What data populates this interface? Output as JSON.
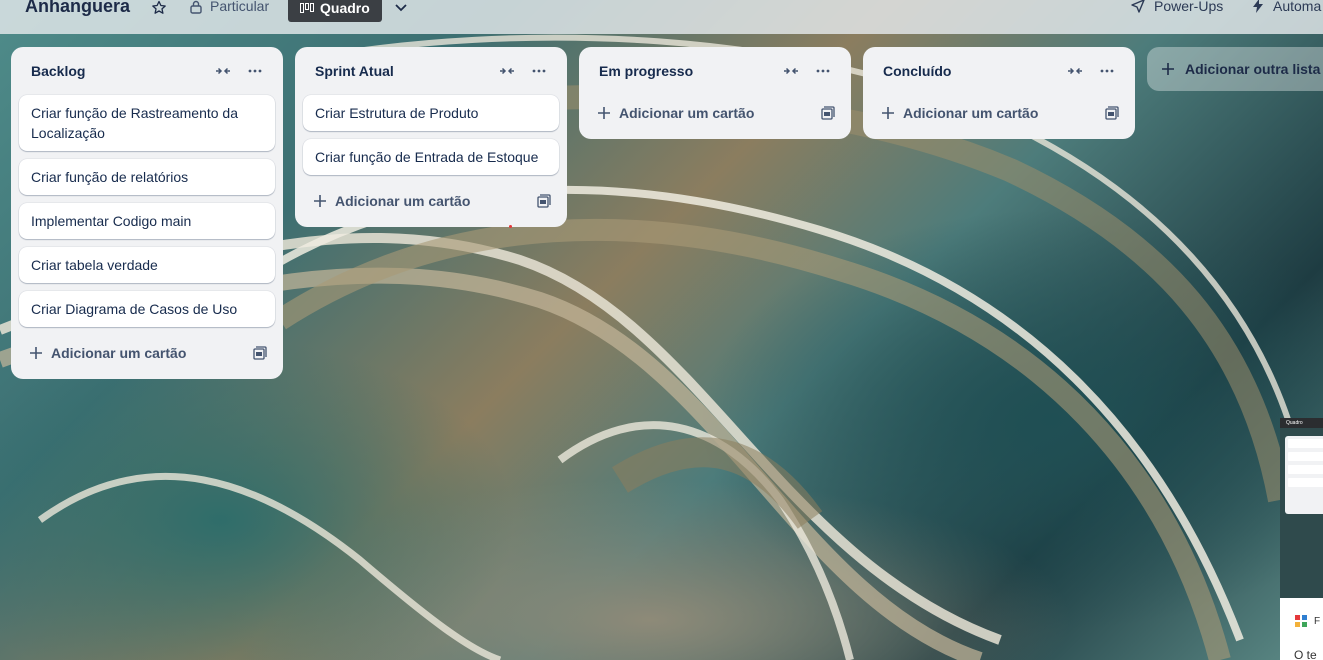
{
  "header": {
    "board_title": "Anhanguera",
    "visibility_label": "Particular",
    "view_label": "Quadro",
    "powerups_label": "Power-Ups",
    "automation_label": "Automa"
  },
  "lists": [
    {
      "title": "Backlog",
      "cards": [
        "Criar função de Rastreamento da Localização",
        "Criar função de relatórios",
        "Implementar Codigo main",
        "Criar tabela verdade",
        "Criar Diagrama de Casos de Uso"
      ],
      "add_card_label": "Adicionar um cartão"
    },
    {
      "title": "Sprint Atual",
      "cards": [
        "Criar Estrutura de Produto",
        "Criar função de Entrada de Estoque"
      ],
      "add_card_label": "Adicionar um cartão"
    },
    {
      "title": "Em progresso",
      "cards": [],
      "add_card_label": "Adicionar um cartão"
    },
    {
      "title": "Concluído",
      "cards": [],
      "add_card_label": "Adicionar um cartão"
    }
  ],
  "add_list_label": "Adicionar outra lista",
  "thumbnail": {
    "label": "Quadro",
    "partial_text": "F",
    "partial_text_2": "O te"
  },
  "icons": {
    "star": "star-icon",
    "lock": "lock-icon",
    "board": "board-view-icon",
    "chevron": "chevron-down-icon",
    "powerups": "rocket-icon",
    "automation": "lightning-icon",
    "collapse": "collapse-list-icon",
    "more": "more-icon",
    "plus": "plus-icon",
    "template": "card-template-icon"
  },
  "colors": {
    "list_bg": "#f1f2f4",
    "card_bg": "#ffffff",
    "text_primary": "#172b4d",
    "text_secondary": "#44546f",
    "view_button_bg": "#3b3f44"
  }
}
